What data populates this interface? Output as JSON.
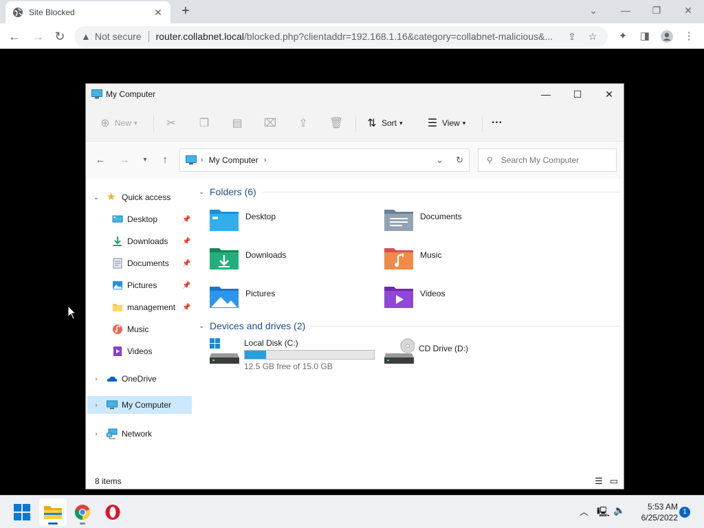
{
  "browser": {
    "tab_title": "Site Blocked",
    "tab_close": "✕",
    "new_tab": "+",
    "security_label": "Not secure",
    "url_host": "router.collabnet.local",
    "url_rest": "/blocked.php?clientaddr=192.168.1.16&category=collabnet-malicious&..."
  },
  "explorer": {
    "title": "My Computer",
    "commands": {
      "new": "New",
      "sort": "Sort",
      "view": "View",
      "more": "···"
    },
    "address": {
      "location": "My Computer"
    },
    "search": {
      "placeholder": "Search My Computer"
    },
    "nav": {
      "quick_access": "Quick access",
      "items": [
        {
          "label": "Desktop",
          "pinned": true
        },
        {
          "label": "Downloads",
          "pinned": true
        },
        {
          "label": "Documents",
          "pinned": true
        },
        {
          "label": "Pictures",
          "pinned": true
        },
        {
          "label": "management",
          "pinned": true
        },
        {
          "label": "Music",
          "pinned": false
        },
        {
          "label": "Videos",
          "pinned": false
        }
      ],
      "onedrive": "OneDrive",
      "my_computer": "My Computer",
      "network": "Network"
    },
    "folders_header": "Folders (6)",
    "folders": [
      {
        "name": "Desktop"
      },
      {
        "name": "Documents"
      },
      {
        "name": "Downloads"
      },
      {
        "name": "Music"
      },
      {
        "name": "Pictures"
      },
      {
        "name": "Videos"
      }
    ],
    "drives_header": "Devices and drives (2)",
    "drives": [
      {
        "name": "Local Disk (C:)",
        "free": "12.5 GB free of 15.0 GB",
        "used_fraction": 0.167
      },
      {
        "name": "CD Drive (D:)"
      }
    ],
    "status": "8 items"
  },
  "taskbar": {
    "time": "5:53 AM",
    "date": "6/25/2022",
    "notification_count": "1"
  },
  "colors": {
    "accent": "#0067c0",
    "selection": "#cce8ff",
    "drive_fill": "#26a0da",
    "group_header": "#1e4e8c"
  }
}
